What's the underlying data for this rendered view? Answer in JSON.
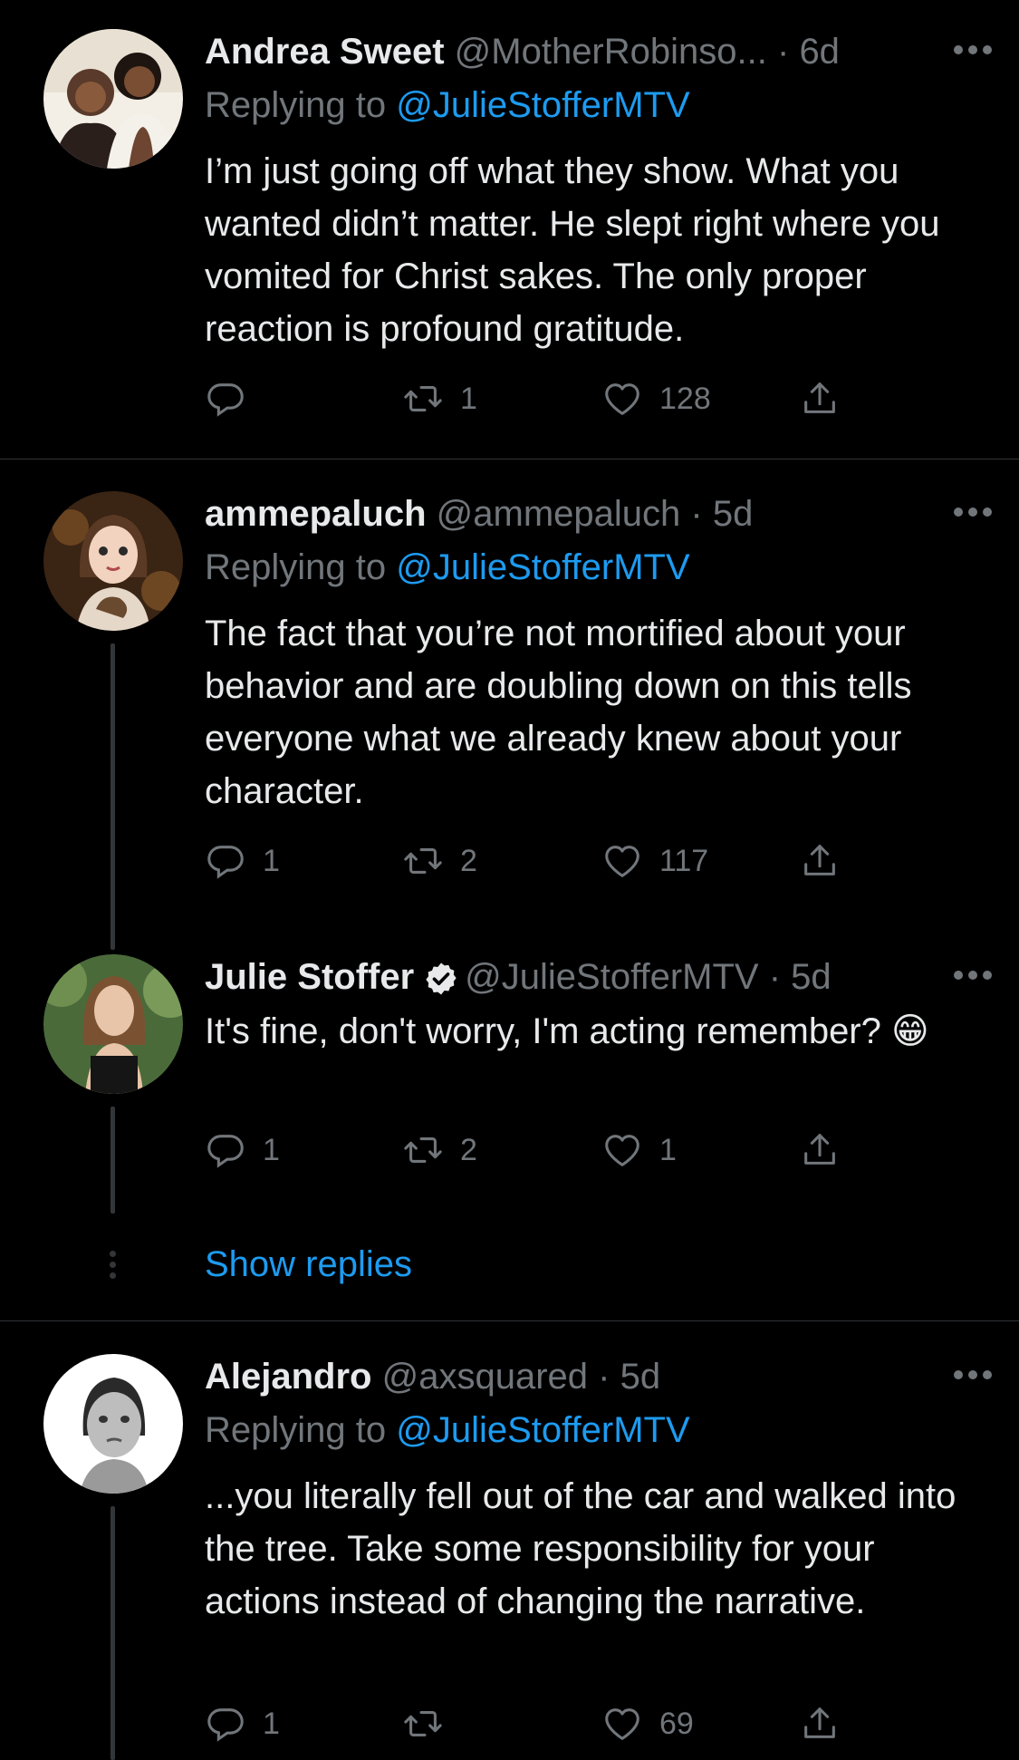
{
  "colors": {
    "background": "#000000",
    "text": "#e7e9ea",
    "secondary": "#71767b",
    "link": "#1d9bf0",
    "divider": "#2f3336"
  },
  "tweets": [
    {
      "name": "Andrea Sweet",
      "handle": "@MotherRobinso...",
      "dot": "·",
      "time": "6d",
      "replying_prefix": "Replying to ",
      "replying_to": "@JulieStofferMTV",
      "text": "I’m just going off what they show. What you wanted didn’t matter. He slept right where you vomited for Christ sakes.  The only proper reaction is profound gratitude.",
      "replies": "",
      "retweets": "1",
      "likes": "128"
    },
    {
      "name": "ammepaluch",
      "handle": "@ammepaluch",
      "dot": "·",
      "time": "5d",
      "replying_prefix": "Replying to ",
      "replying_to": "@JulieStofferMTV",
      "text": "The fact that you’re not mortified about your behavior and are doubling down on this tells everyone what we already knew about your character.",
      "replies": "1",
      "retweets": "2",
      "likes": "117"
    },
    {
      "name": "Julie Stoffer",
      "verified_icon": "verified-badge-icon",
      "handle": "@JulieStofferMTV",
      "dot": "·",
      "time": "5d",
      "text": "It's fine, don't worry, I'm acting remember? 😁",
      "replies": "1",
      "retweets": "2",
      "likes": "1"
    },
    {
      "name": "Alejandro",
      "handle": "@axsquared",
      "dot": "·",
      "time": "5d",
      "replying_prefix": "Replying to ",
      "replying_to": "@JulieStofferMTV",
      "text": "...you literally fell out of the car and walked into the tree. Take some responsibility for your actions instead of changing the narrative.",
      "replies": "1",
      "retweets": "",
      "likes": "69"
    }
  ],
  "show_replies_label": "Show replies"
}
